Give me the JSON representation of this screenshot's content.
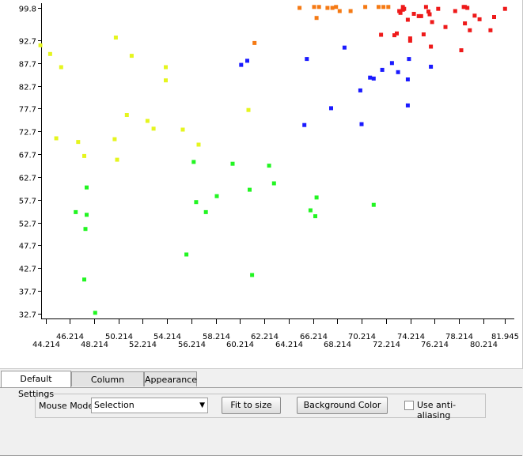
{
  "chart_data": {
    "type": "scatter",
    "title": "",
    "xlabel": "",
    "ylabel": "",
    "xlim": [
      43.6,
      82.3
    ],
    "ylim": [
      32.0,
      100.6
    ],
    "grid": false,
    "x_ticks_upper": [
      "46.214",
      "50.214",
      "54.214",
      "58.214",
      "62.214",
      "66.214",
      "70.214",
      "74.214",
      "78.214",
      "81.945"
    ],
    "x_ticks_lower": [
      "44.214",
      "48.214",
      "52.214",
      "56.214",
      "60.214",
      "64.214",
      "68.214",
      "72.214",
      "76.214",
      "80.214"
    ],
    "y_ticks": [
      "99.8",
      "92.7",
      "87.7",
      "82.7",
      "77.7",
      "72.7",
      "67.7",
      "62.7",
      "57.7",
      "52.7",
      "47.7",
      "42.7",
      "37.7",
      "32.7"
    ],
    "series": [
      {
        "color": "#e5f51e",
        "points": [
          [
            43.8,
            91.6
          ],
          [
            44.6,
            89.7
          ],
          [
            45.5,
            86.8
          ],
          [
            45.1,
            71.2
          ],
          [
            46.9,
            70.4
          ],
          [
            47.4,
            67.3
          ],
          [
            49.9,
            71.0
          ],
          [
            50.1,
            66.5
          ],
          [
            50.0,
            93.3
          ],
          [
            50.9,
            76.3
          ],
          [
            51.3,
            89.3
          ],
          [
            52.6,
            75.0
          ],
          [
            53.1,
            73.3
          ],
          [
            54.1,
            86.8
          ],
          [
            54.1,
            83.9
          ],
          [
            55.5,
            73.1
          ],
          [
            56.8,
            69.8
          ],
          [
            60.9,
            77.4
          ]
        ]
      },
      {
        "color": "#22f522",
        "points": [
          [
            46.7,
            55.0
          ],
          [
            47.6,
            60.4
          ],
          [
            47.6,
            54.4
          ],
          [
            47.5,
            51.3
          ],
          [
            47.4,
            40.2
          ],
          [
            48.3,
            32.9
          ],
          [
            55.8,
            45.7
          ],
          [
            56.4,
            66.0
          ],
          [
            56.6,
            57.2
          ],
          [
            57.4,
            55.0
          ],
          [
            58.3,
            58.5
          ],
          [
            59.6,
            65.6
          ],
          [
            61.0,
            59.9
          ],
          [
            61.2,
            41.2
          ],
          [
            62.6,
            65.2
          ],
          [
            63.0,
            61.3
          ],
          [
            66.0,
            55.4
          ],
          [
            66.4,
            54.1
          ],
          [
            66.5,
            58.2
          ],
          [
            71.2,
            56.6
          ]
        ]
      },
      {
        "color": "#1a1aff",
        "points": [
          [
            60.3,
            87.3
          ],
          [
            60.8,
            88.2
          ],
          [
            65.5,
            74.1
          ],
          [
            65.7,
            88.6
          ],
          [
            67.7,
            77.8
          ],
          [
            68.8,
            91.1
          ],
          [
            70.1,
            81.7
          ],
          [
            70.2,
            74.3
          ],
          [
            70.9,
            84.5
          ],
          [
            71.2,
            84.3
          ],
          [
            71.9,
            86.2
          ],
          [
            72.7,
            87.7
          ],
          [
            73.2,
            85.7
          ],
          [
            74.0,
            78.4
          ],
          [
            74.0,
            84.1
          ],
          [
            74.1,
            88.6
          ],
          [
            75.9,
            86.9
          ]
        ]
      },
      {
        "color": "#f57a14",
        "points": [
          [
            61.4,
            92.1
          ],
          [
            65.1,
            99.8
          ],
          [
            66.3,
            100.0
          ],
          [
            66.5,
            97.6
          ],
          [
            66.7,
            100.0
          ],
          [
            67.4,
            99.8
          ],
          [
            67.8,
            99.8
          ],
          [
            68.1,
            100.0
          ],
          [
            68.4,
            99.1
          ],
          [
            69.3,
            99.1
          ],
          [
            70.5,
            100.0
          ],
          [
            71.6,
            100.0
          ],
          [
            72.0,
            100.0
          ],
          [
            72.4,
            100.0
          ]
        ]
      },
      {
        "color": "#ee1a1a",
        "points": [
          [
            71.8,
            93.9
          ],
          [
            72.9,
            93.8
          ],
          [
            73.1,
            94.2
          ],
          [
            73.3,
            99.1
          ],
          [
            73.4,
            98.7
          ],
          [
            73.6,
            100.0
          ],
          [
            73.7,
            99.6
          ],
          [
            74.2,
            92.6
          ],
          [
            74.2,
            93.1
          ],
          [
            74.5,
            98.5
          ],
          [
            74.9,
            98.0
          ],
          [
            75.1,
            98.0
          ],
          [
            75.3,
            94.0
          ],
          [
            75.5,
            100.0
          ],
          [
            75.7,
            99.0
          ],
          [
            75.8,
            98.4
          ],
          [
            75.9,
            91.3
          ],
          [
            76.0,
            96.7
          ],
          [
            76.5,
            99.6
          ],
          [
            77.1,
            95.6
          ],
          [
            77.9,
            99.1
          ],
          [
            78.4,
            90.5
          ],
          [
            78.6,
            100.0
          ],
          [
            78.7,
            100.0
          ],
          [
            78.7,
            96.4
          ],
          [
            78.9,
            99.8
          ],
          [
            79.1,
            94.9
          ],
          [
            79.5,
            98.1
          ],
          [
            79.9,
            97.3
          ],
          [
            80.8,
            94.9
          ],
          [
            81.1,
            97.8
          ],
          [
            82.0,
            99.6
          ],
          [
            74.0,
            97.2
          ],
          [
            73.6,
            99.4
          ]
        ]
      }
    ]
  },
  "tabs": [
    "Default Settings",
    "Column Selection",
    "Appearance"
  ],
  "controls": {
    "mouse_mode_label": "Mouse Mode",
    "mouse_mode_value": "Selection",
    "fit_button": "Fit to size",
    "background_button": "Background Color",
    "antialias_label": "Use anti-aliasing",
    "antialias_checked": false
  }
}
